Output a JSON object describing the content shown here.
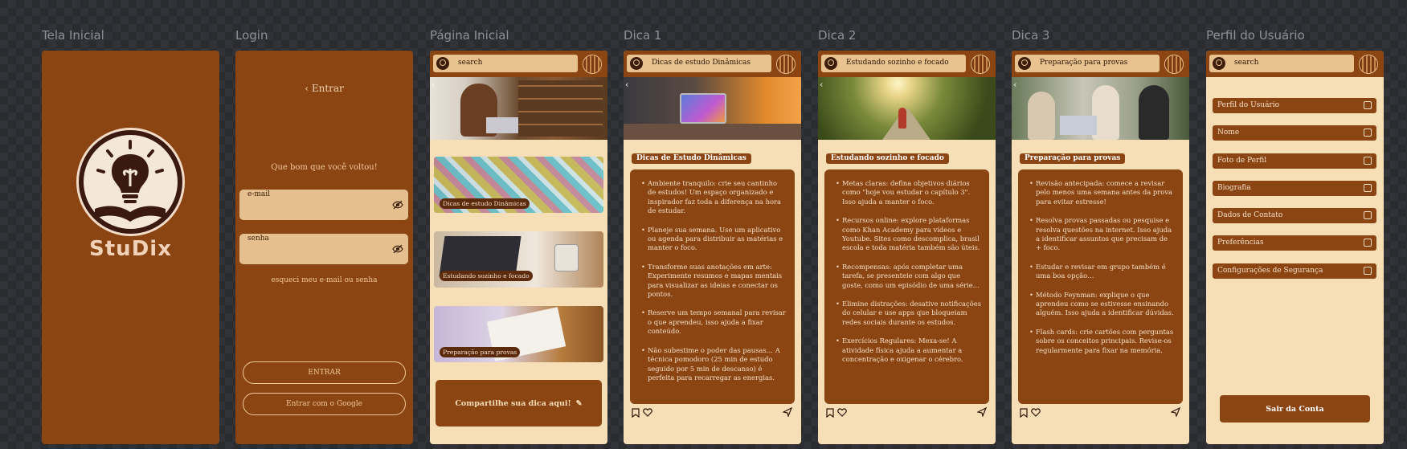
{
  "labels": [
    "Tela Inicial",
    "Login",
    "Página Inicial",
    "Dica 1",
    "Dica 2",
    "Dica 3",
    "Perfil do Usuário"
  ],
  "colors": {
    "brand": "#8b4513",
    "cream": "#f6deb7",
    "canvas": "#2a2c30"
  },
  "splash": {
    "logo_text": "StuDix",
    "logo_icon": "lightbulb-book-icon"
  },
  "login": {
    "title": "Entrar",
    "welcome": "Que bom que você voltou!",
    "email_label": "e-mail",
    "password_label": "senha",
    "forgot": "esqueci meu e-mail ou senha",
    "enter_button": "ENTRAR",
    "google_button": "Entrar com o Google"
  },
  "home": {
    "search": "search",
    "tips": [
      "Dicas de estudo Dinâmicas",
      "Estudando sozinho e focado",
      "Preparação para provas"
    ],
    "share": "Compartilhe sua dica aqui!"
  },
  "dica1": {
    "search": "Dicas de estudo Dinâmicas",
    "pill": "Dicas de Estudo Dinâmicas",
    "items": [
      "Ambiente tranquilo: crie seu cantinho de estudos! Um espaço organizado e inspirador faz toda a diferença na hora de estudar.",
      "Planeje sua semana. Use um aplicativo ou agenda para distribuir as matérias e manter o foco.",
      "Transforme suas anotações em arte: Experimente resumos e mapas mentais para visualizar as ideias e conectar os pontos.",
      "Reserve um tempo semanal para revisar o que aprendeu, isso ajuda a fixar conteúdo.",
      "Não subestime o poder das pausas… A técnica pomodoro (25 min de estudo seguido por 5 min de descanso) é perfeita para recarregar as energias."
    ]
  },
  "dica2": {
    "search": "Estudando sozinho e focado",
    "pill": "Estudando sozinho e focado",
    "items": [
      "Metas claras: defina objetivos diários como \"hoje vou estudar o capítulo 3\". Isso ajuda a manter o foco.",
      "Recursos online: explore plataformas como Khan Academy para vídeos e Youtube. Sites como descomplica, brasil escola e toda matéria também são úteis.",
      "Recompensas: após completar uma tarefa, se presenteie com algo que goste, como um episódio de uma série…",
      "Elimine distrações: desative notificações do celular e use apps que bloqueiam redes sociais durante os estudos.",
      "Exercícios Regulares: Mexa-se! A atividade física ajuda a aumentar a concentração e oxigenar o cérebro."
    ]
  },
  "dica3": {
    "search": "Preparação para provas",
    "pill": "Preparação para provas",
    "items": [
      "Revisão antecipada: comece a revisar pelo menos uma semana antes da prova para evitar estresse!",
      "Resolva provas passadas ou pesquise e resolva questões na internet. Isso ajuda a identificar assuntos que precisam de + foco.",
      "Estudar e revisar em grupo também é uma boa opção…",
      "Método Feynman: explique o que aprendeu como se estivesse ensinando alguém. Isso ajuda a identificar dúvidas.",
      "Flash cards: crie cartões com perguntas sobre os conceitos principais. Revise-os regularmente para fixar na memória."
    ]
  },
  "profile": {
    "search": "search",
    "items": [
      "Perfil do Usuário",
      "Nome",
      "Foto de Perfil",
      "Biografia",
      "Dados de Contato",
      "Preferências",
      "Configurações de Segurança"
    ],
    "logout": "Sair da Conta"
  }
}
